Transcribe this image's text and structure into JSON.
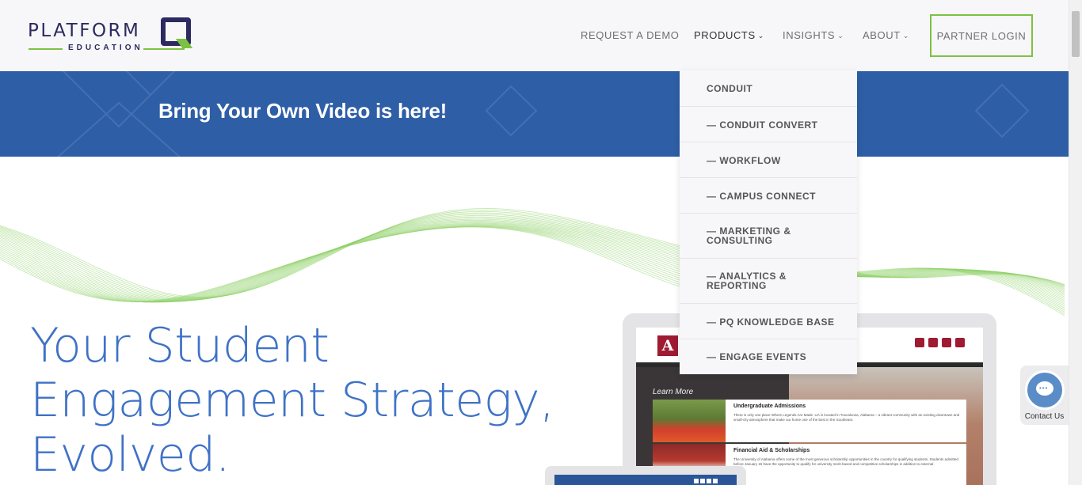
{
  "header": {
    "logo": {
      "name": "PLATFORM",
      "sub": "EDUCATION",
      "mark": "Q"
    },
    "nav": [
      {
        "label": "REQUEST A DEMO",
        "has_dropdown": false
      },
      {
        "label": "PRODUCTS",
        "has_dropdown": true
      },
      {
        "label": "INSIGHTS",
        "has_dropdown": true
      },
      {
        "label": "ABOUT",
        "has_dropdown": true
      }
    ],
    "partner_login": "PARTNER LOGIN",
    "chevron": "⌄"
  },
  "banner": {
    "text": "Bring Your Own Video is here!"
  },
  "hero": {
    "title_lines": [
      "Your Student",
      "Engagement Strategy,",
      "Evolved."
    ]
  },
  "products_menu": {
    "items": [
      {
        "lines": [
          "CONDUIT"
        ]
      },
      {
        "lines": [
          "— CONDUIT CONVERT"
        ]
      },
      {
        "lines": [
          "— WORKFLOW"
        ]
      },
      {
        "lines": [
          "— CAMPUS CONNECT"
        ]
      },
      {
        "lines": [
          "— MARKETING &",
          "CONSULTING"
        ]
      },
      {
        "lines": [
          "— ANALYTICS &",
          "REPORTING"
        ]
      },
      {
        "lines": [
          "— PQ KNOWLEDGE BASE"
        ]
      },
      {
        "lines": [
          "— ENGAGE EVENTS"
        ]
      }
    ]
  },
  "mockup": {
    "logo_letter": "A",
    "learn_more": "Learn More",
    "cards": [
      {
        "title": "Undergraduate Admissions",
        "text": "There is only one place Where Legends Are Made. UA is located in Tuscaloosa, Alabama – a vibrant community with an existing downtown and small-city atmosphere that make our home one of the best in the Southeast."
      },
      {
        "title": "Financial Aid & Scholarships",
        "text": "The University of Alabama offers some of the most generous scholarship opportunities in the country for qualifying students. Students admitted before January 15 have the opportunity to qualify for university merit-based and competitive scholarships in addition to external"
      }
    ]
  },
  "contact_widget": {
    "label": "Contact Us",
    "dots": "•••"
  },
  "colors": {
    "brand_navy": "#2c2a5e",
    "brand_green": "#7cc242",
    "banner_blue": "#2e5ea5",
    "hero_blue": "#3f72c6",
    "alabama_crimson": "#9e1b32"
  }
}
